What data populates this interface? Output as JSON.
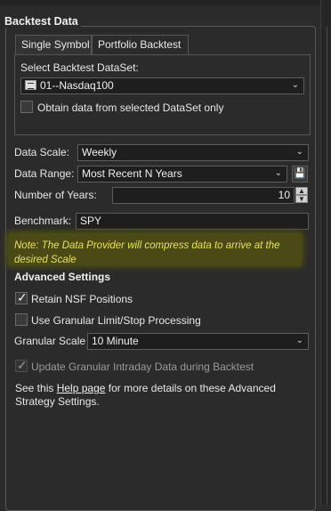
{
  "group": {
    "title": "Backtest Data"
  },
  "tabs": [
    {
      "label": "Single Symbol"
    },
    {
      "label": "Portfolio Backtest"
    }
  ],
  "portfolio": {
    "dataset_label": "Select Backtest DataSet:",
    "dataset_value": "01--Nasdaq100",
    "dataset_icon": "dataset-grid-icon",
    "obtain_only_label": "Obtain data from selected DataSet only",
    "obtain_only_checked": false
  },
  "fields": {
    "data_scale_label": "Data Scale:",
    "data_scale_value": "Weekly",
    "data_range_label": "Data Range:",
    "data_range_value": "Most Recent N Years",
    "num_years_label": "Number of Years:",
    "num_years_value": "10",
    "benchmark_label": "Benchmark:",
    "benchmark_value": "SPY"
  },
  "note": {
    "text": "Note: The Data Provider will compress data to arrive at the desired Scale"
  },
  "advanced": {
    "title": "Advanced Settings",
    "retain_nsf_label": "Retain NSF Positions",
    "retain_nsf_checked": true,
    "granular_limit_label": "Use Granular Limit/Stop Processing",
    "granular_limit_checked": false,
    "granular_scale_label": "Granular Scale",
    "granular_scale_value": "10 Minute",
    "update_intraday_label": "Update Granular Intraday Data during Backtest",
    "update_intraday_checked": true,
    "help_prefix": "See this ",
    "help_link": "Help page",
    "help_suffix": " for more details on these Advanced Strategy Settings."
  },
  "colors": {
    "background": "#2b2b2b",
    "note_highlight": "#4a4a16",
    "note_text": "#e8e25a"
  }
}
